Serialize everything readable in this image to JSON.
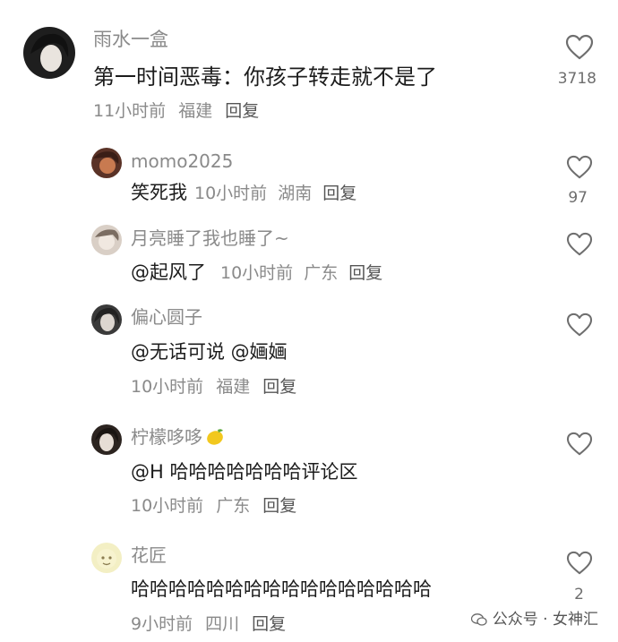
{
  "comments": [
    {
      "username": "雨水一盒",
      "text": "第一时间恶毒：你孩子转走就不是了",
      "time": "11小时前",
      "location": "福建",
      "reply_label": "回复",
      "likes": "3718",
      "avatar_colors": [
        "#1e1e1e",
        "#e9e4de"
      ]
    },
    {
      "username": "momo2025",
      "text": "笑死我",
      "time": "10小时前",
      "location": "湖南",
      "reply_label": "回复",
      "likes": "97",
      "avatar_colors": [
        "#5a3226",
        "#c87a50"
      ]
    },
    {
      "username": "月亮睡了我也睡了~",
      "mention": "@起风了",
      "time": "10小时前",
      "location": "广东",
      "reply_label": "回复",
      "likes": "",
      "avatar_colors": [
        "#d9cfc6",
        "#7b6d62"
      ]
    },
    {
      "username": "偏心圆子",
      "text": "@无话可说 @婳婳",
      "time": "10小时前",
      "location": "福建",
      "reply_label": "回复",
      "likes": "",
      "avatar_colors": [
        "#3a3a3a",
        "#dcd6d0"
      ]
    },
    {
      "username": "柠檬哆哆",
      "username_emoji": "lemon-emoji",
      "text": "@H 哈哈哈哈哈哈哈评论区",
      "time": "10小时前",
      "location": "广东",
      "reply_label": "回复",
      "likes": "",
      "avatar_colors": [
        "#2c2420",
        "#e6ddd5"
      ]
    },
    {
      "username": "花匠",
      "text": "哈哈哈哈哈哈哈哈哈哈哈哈哈哈哈哈",
      "time": "9小时前",
      "location": "四川",
      "reply_label": "回复",
      "likes": "2",
      "avatar_colors": [
        "#f3efc4",
        "#8b7d50"
      ]
    }
  ],
  "watermark": {
    "text": "公众号 · 女神汇",
    "icon": "wechat-icon"
  },
  "colors": {
    "username": "#8a8a8a",
    "meta": "#8a8a8a",
    "text": "#1c1c1c",
    "heart": "#6e6e6e"
  }
}
